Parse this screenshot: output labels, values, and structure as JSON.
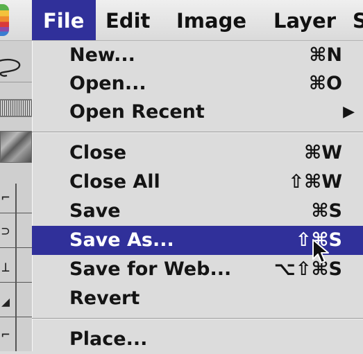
{
  "menubar": {
    "items": [
      "File",
      "Edit",
      "Image",
      "Layer",
      "S"
    ]
  },
  "file_menu": {
    "items": [
      {
        "label": "New...",
        "shortcut": "⌘N"
      },
      {
        "label": "Open...",
        "shortcut": "⌘O"
      },
      {
        "label": "Open Recent",
        "submenu": "▶"
      },
      {
        "label": "Close",
        "shortcut": "⌘W"
      },
      {
        "label": "Close All",
        "shortcut": "⇧⌘W"
      },
      {
        "label": "Save",
        "shortcut": "⌘S"
      },
      {
        "label": "Save As...",
        "shortcut": "⇧⌘S",
        "highlighted": true
      },
      {
        "label": "Save for Web...",
        "shortcut": "⌥⇧⌘S"
      },
      {
        "label": "Revert"
      },
      {
        "label": "Place..."
      }
    ]
  },
  "colors": {
    "highlight": "#30309a",
    "menu_background": "#dcdcdc",
    "text": "#141414"
  },
  "icons": [
    "apple-menu-icon",
    "lasso-tool-icon",
    "mouse-pointer-icon",
    "submenu-arrow-icon"
  ]
}
